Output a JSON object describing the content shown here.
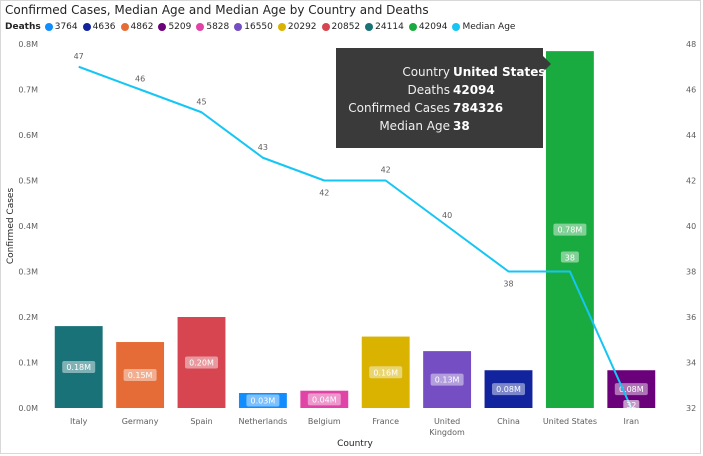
{
  "title": "Confirmed Cases, Median Age and Median Age by Country and Deaths",
  "legend": {
    "title": "Deaths",
    "items": [
      {
        "label": "3764",
        "color": "#118DFF"
      },
      {
        "label": "4636",
        "color": "#12239E"
      },
      {
        "label": "4862",
        "color": "#E66C37"
      },
      {
        "label": "5209",
        "color": "#6B007B"
      },
      {
        "label": "5828",
        "color": "#E044A7"
      },
      {
        "label": "16550",
        "color": "#744EC2"
      },
      {
        "label": "20292",
        "color": "#D9B300"
      },
      {
        "label": "20852",
        "color": "#D64550"
      },
      {
        "label": "24114",
        "color": "#197278"
      },
      {
        "label": "42094",
        "color": "#1AAB40"
      },
      {
        "label": "Median Age",
        "color": "#15C6F4"
      }
    ]
  },
  "tooltip": {
    "rows": [
      {
        "key": "Country",
        "value": "United States"
      },
      {
        "key": "Deaths",
        "value": "42094"
      },
      {
        "key": "Confirmed Cases",
        "value": "784326"
      },
      {
        "key": "Median Age",
        "value": "38"
      }
    ]
  },
  "chart_data": {
    "type": "bar",
    "xlabel": "Country",
    "ylabel": "Confirmed Cases",
    "ylim": [
      0,
      800000
    ],
    "y_ticks": [
      "0.0M",
      "0.1M",
      "0.2M",
      "0.3M",
      "0.4M",
      "0.5M",
      "0.6M",
      "0.7M",
      "0.8M"
    ],
    "y2lim": [
      32,
      48
    ],
    "y2_ticks": [
      "32",
      "34",
      "36",
      "38",
      "40",
      "42",
      "44",
      "46",
      "48"
    ],
    "categories": [
      {
        "name": "Italy",
        "lines": [
          "Italy"
        ]
      },
      {
        "name": "Germany",
        "lines": [
          "Germany"
        ]
      },
      {
        "name": "Spain",
        "lines": [
          "Spain"
        ]
      },
      {
        "name": "Netherlands",
        "lines": [
          "Netherlands"
        ]
      },
      {
        "name": "Belgium",
        "lines": [
          "Belgium"
        ]
      },
      {
        "name": "France",
        "lines": [
          "France"
        ]
      },
      {
        "name": "United Kingdom",
        "lines": [
          "United",
          "Kingdom"
        ]
      },
      {
        "name": "China",
        "lines": [
          "China"
        ]
      },
      {
        "name": "United States",
        "lines": [
          "United States"
        ]
      },
      {
        "name": "Iran",
        "lines": [
          "Iran"
        ]
      }
    ],
    "bars": [
      {
        "value": 180000,
        "label": "0.18M",
        "deaths": "24114",
        "color": "#197278"
      },
      {
        "value": 145000,
        "label": "0.15M",
        "deaths": "4862",
        "color": "#E66C37"
      },
      {
        "value": 200000,
        "label": "0.20M",
        "deaths": "20852",
        "color": "#D64550"
      },
      {
        "value": 33000,
        "label": "0.03M",
        "deaths": "3764",
        "color": "#118DFF"
      },
      {
        "value": 38000,
        "label": "0.04M",
        "deaths": "5828",
        "color": "#E044A7"
      },
      {
        "value": 157000,
        "label": "0.16M",
        "deaths": "20292",
        "color": "#D9B300"
      },
      {
        "value": 125000,
        "label": "0.13M",
        "deaths": "16550",
        "color": "#744EC2"
      },
      {
        "value": 83000,
        "label": "0.08M",
        "deaths": "4636",
        "color": "#12239E"
      },
      {
        "value": 784326,
        "label": "0.78M",
        "deaths": "42094",
        "color": "#1AAB40"
      },
      {
        "value": 83000,
        "label": "0.08M",
        "deaths": "5209",
        "color": "#6B007B"
      }
    ],
    "line": {
      "name": "Median Age",
      "color": "#15C6F4",
      "values": [
        47,
        46,
        45,
        43,
        42,
        42,
        40,
        38,
        38,
        32
      ]
    }
  }
}
